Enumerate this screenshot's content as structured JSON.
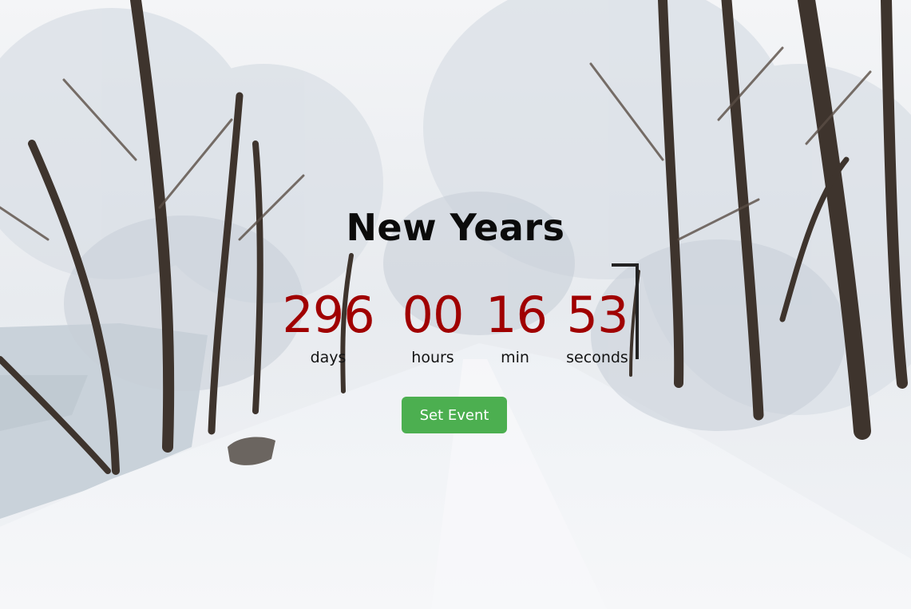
{
  "event": {
    "title": "New Years"
  },
  "countdown": {
    "days": {
      "value": "296",
      "label": "days"
    },
    "hours": {
      "value": "00",
      "label": "hours"
    },
    "minutes": {
      "value": "16",
      "label": "min"
    },
    "seconds": {
      "value": "53",
      "label": "seconds"
    }
  },
  "actions": {
    "set_event_label": "Set Event"
  },
  "colors": {
    "number": "#a00000",
    "button": "#4caf50",
    "title": "#0b0b0b"
  }
}
